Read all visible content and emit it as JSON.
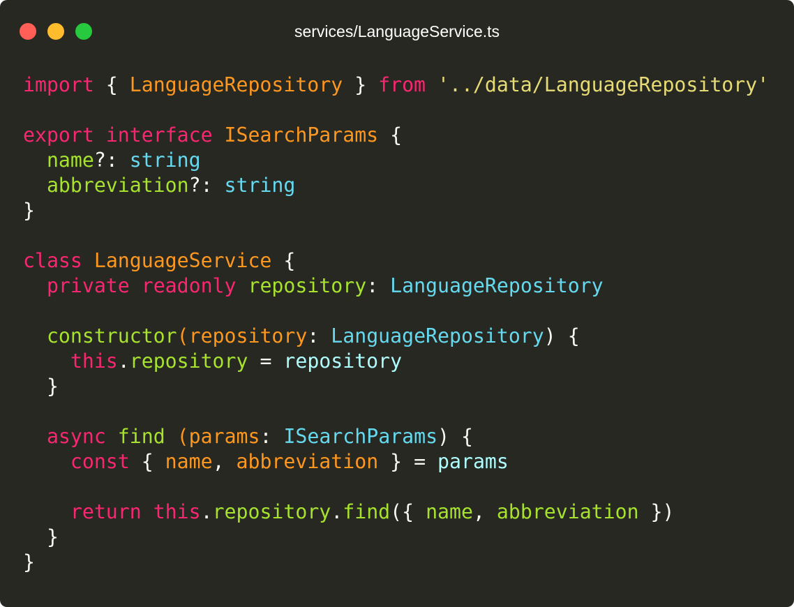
{
  "window": {
    "title": "services/LanguageService.ts",
    "traffic_lights": {
      "close_color": "#ff5f56",
      "minimize_color": "#ffbd2e",
      "zoom_color": "#27c93f"
    },
    "background_color": "#272822"
  },
  "theme": {
    "keyword": "#f92672",
    "class_name": "#fd971f",
    "param": "#fd971f",
    "property": "#a6e22e",
    "type": "#66d9ef",
    "string": "#e6db74",
    "variable": "#f8f8f2",
    "identifier": "#aefcfc",
    "default": "#f8f8f2"
  },
  "code": {
    "lines": [
      [
        {
          "t": "import",
          "k": "keyword"
        },
        {
          "t": " { ",
          "k": "default"
        },
        {
          "t": "LanguageRepository",
          "k": "class_name"
        },
        {
          "t": " } ",
          "k": "default"
        },
        {
          "t": "from",
          "k": "keyword"
        },
        {
          "t": " ",
          "k": "default"
        },
        {
          "t": "'../data/LanguageRepository'",
          "k": "string"
        }
      ],
      [],
      [
        {
          "t": "export",
          "k": "keyword"
        },
        {
          "t": " ",
          "k": "default"
        },
        {
          "t": "interface",
          "k": "keyword"
        },
        {
          "t": " ",
          "k": "default"
        },
        {
          "t": "ISearchParams",
          "k": "class_name"
        },
        {
          "t": " {",
          "k": "default"
        }
      ],
      [
        {
          "t": "  ",
          "k": "default"
        },
        {
          "t": "name",
          "k": "property"
        },
        {
          "t": "?: ",
          "k": "default"
        },
        {
          "t": "string",
          "k": "type"
        }
      ],
      [
        {
          "t": "  ",
          "k": "default"
        },
        {
          "t": "abbreviation",
          "k": "property"
        },
        {
          "t": "?: ",
          "k": "default"
        },
        {
          "t": "string",
          "k": "type"
        }
      ],
      [
        {
          "t": "}",
          "k": "default"
        }
      ],
      [],
      [
        {
          "t": "class",
          "k": "keyword"
        },
        {
          "t": " ",
          "k": "default"
        },
        {
          "t": "LanguageService",
          "k": "class_name"
        },
        {
          "t": " {",
          "k": "default"
        }
      ],
      [
        {
          "t": "  ",
          "k": "default"
        },
        {
          "t": "private",
          "k": "keyword"
        },
        {
          "t": " ",
          "k": "default"
        },
        {
          "t": "readonly",
          "k": "keyword"
        },
        {
          "t": " ",
          "k": "default"
        },
        {
          "t": "repository",
          "k": "property"
        },
        {
          "t": ": ",
          "k": "default"
        },
        {
          "t": "LanguageRepository",
          "k": "type"
        }
      ],
      [],
      [
        {
          "t": "  ",
          "k": "default"
        },
        {
          "t": "constructor",
          "k": "property"
        },
        {
          "t": "(",
          "k": "class_name"
        },
        {
          "t": "repository",
          "k": "param"
        },
        {
          "t": ": ",
          "k": "default"
        },
        {
          "t": "LanguageRepository",
          "k": "type"
        },
        {
          "t": ") {",
          "k": "default"
        }
      ],
      [
        {
          "t": "    ",
          "k": "default"
        },
        {
          "t": "this",
          "k": "keyword"
        },
        {
          "t": ".",
          "k": "default"
        },
        {
          "t": "repository",
          "k": "property"
        },
        {
          "t": " = ",
          "k": "default"
        },
        {
          "t": "repository",
          "k": "identifier"
        }
      ],
      [
        {
          "t": "  }",
          "k": "default"
        }
      ],
      [],
      [
        {
          "t": "  ",
          "k": "default"
        },
        {
          "t": "async",
          "k": "keyword"
        },
        {
          "t": " ",
          "k": "default"
        },
        {
          "t": "find",
          "k": "property"
        },
        {
          "t": " ",
          "k": "default"
        },
        {
          "t": "(",
          "k": "class_name"
        },
        {
          "t": "params",
          "k": "param"
        },
        {
          "t": ": ",
          "k": "default"
        },
        {
          "t": "ISearchParams",
          "k": "type"
        },
        {
          "t": ") {",
          "k": "default"
        }
      ],
      [
        {
          "t": "    ",
          "k": "default"
        },
        {
          "t": "const",
          "k": "keyword"
        },
        {
          "t": " { ",
          "k": "default"
        },
        {
          "t": "name",
          "k": "param"
        },
        {
          "t": ", ",
          "k": "default"
        },
        {
          "t": "abbreviation",
          "k": "param"
        },
        {
          "t": " } = ",
          "k": "default"
        },
        {
          "t": "params",
          "k": "identifier"
        }
      ],
      [],
      [
        {
          "t": "    ",
          "k": "default"
        },
        {
          "t": "return",
          "k": "keyword"
        },
        {
          "t": " ",
          "k": "default"
        },
        {
          "t": "this",
          "k": "keyword"
        },
        {
          "t": ".",
          "k": "default"
        },
        {
          "t": "repository",
          "k": "property"
        },
        {
          "t": ".",
          "k": "default"
        },
        {
          "t": "find",
          "k": "property"
        },
        {
          "t": "({ ",
          "k": "default"
        },
        {
          "t": "name",
          "k": "property"
        },
        {
          "t": ", ",
          "k": "default"
        },
        {
          "t": "abbreviation",
          "k": "property"
        },
        {
          "t": " })",
          "k": "default"
        }
      ],
      [
        {
          "t": "  }",
          "k": "default"
        }
      ],
      [
        {
          "t": "}",
          "k": "default"
        }
      ]
    ]
  }
}
